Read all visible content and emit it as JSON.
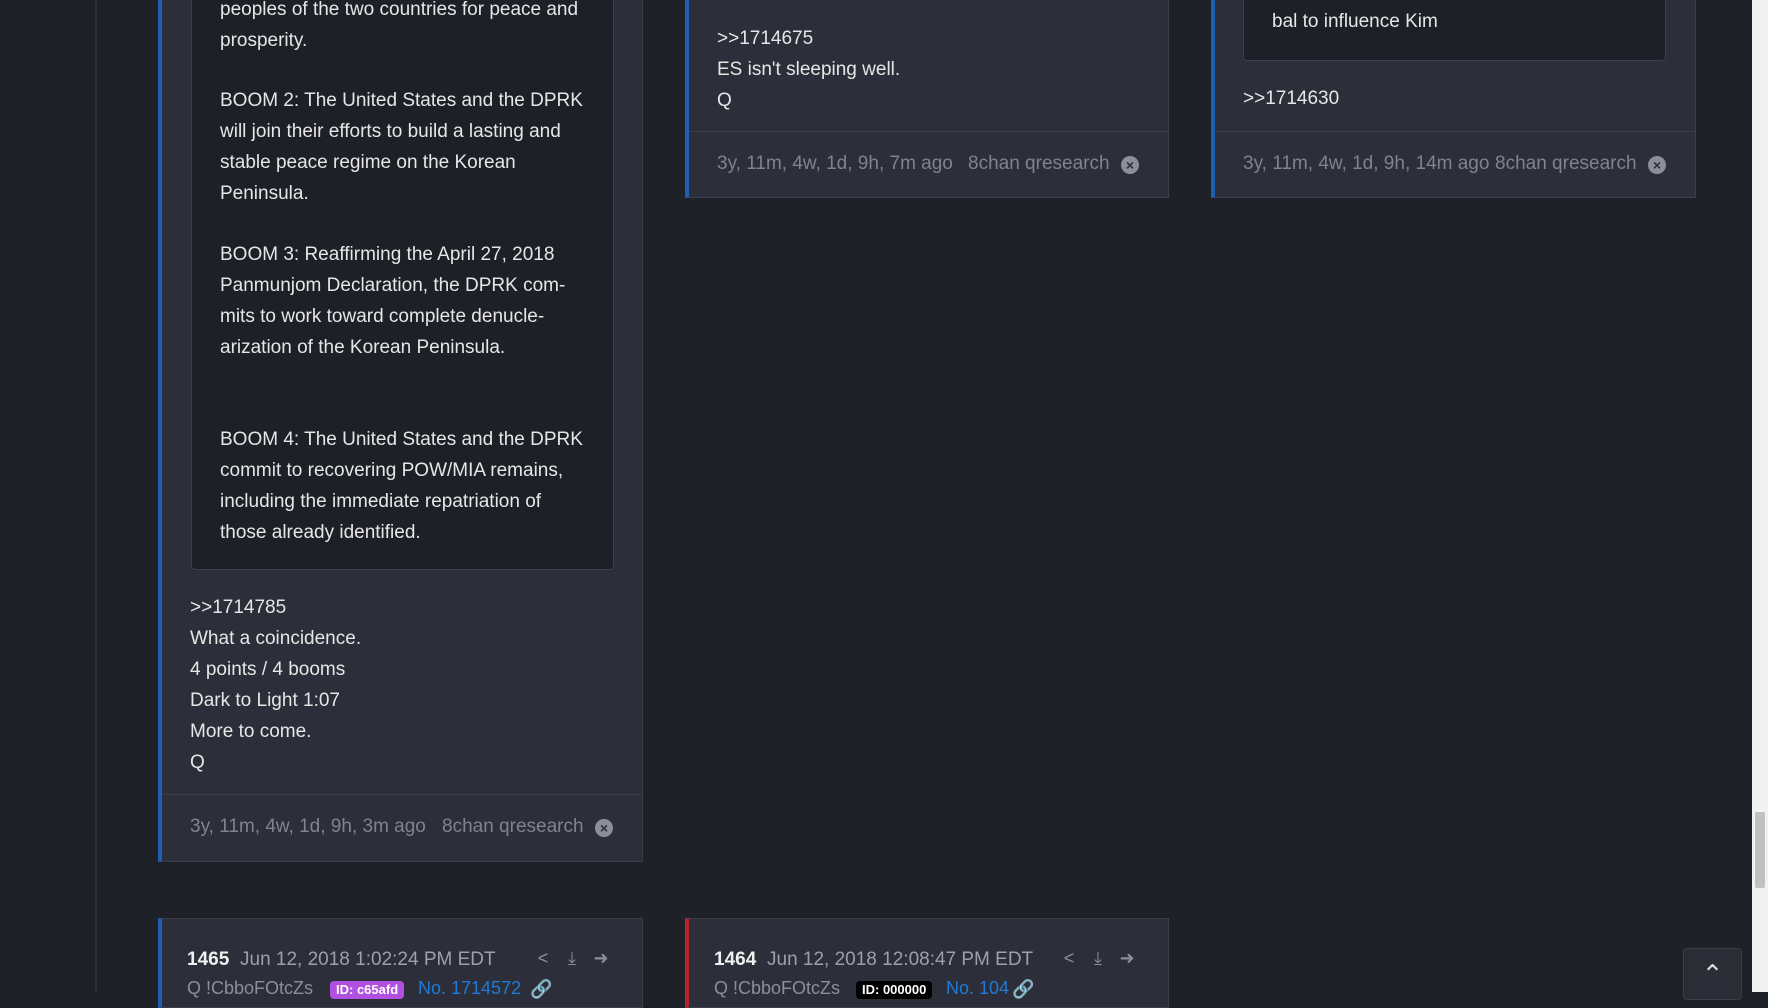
{
  "card_left": {
    "quote_lines": [
      "peoples of the two countries for peace and\nprosperity.",
      "BOOM 2: The United States and the DPRK\nwill join their efforts to build a lasting and\nstable peace regime on the Korean\nPeninsula.",
      "BOOM 3: Reaffirming the April 27, 2018\nPanmunjom Declaration, the DPRK com-\nmits to work toward complete denucle-\narization of the Korean Peninsula.",
      "BOOM 4: The United States and the DPRK\ncommit to recovering POW/MIA remains,\nincluding the immediate repatriation of\nthose already identified."
    ],
    "body": ">>1714785\nWhat a coincidence.\n4 points / 4 booms\nDark to Light 1:07\nMore to come.\nQ",
    "age": "3y, 11m, 4w, 1d, 9h, 3m ago",
    "source": "8chan qresearch"
  },
  "card_middle": {
    "body": ">>1714675\nES isn't sleeping well.\nQ",
    "age": "3y, 11m, 4w, 1d, 9h, 7m ago",
    "source": "8chan qresearch"
  },
  "card_right": {
    "quote_tail": "bal to influence Kim",
    "body": ">>1714630",
    "age": "3y, 11m, 4w, 1d, 9h, 14m ago",
    "source": "8chan qresearch"
  },
  "post_1465": {
    "number": "1465",
    "date": "Jun 12, 2018 1:02:24 PM EDT",
    "author": "Q !CbboFOtcZs",
    "id_badge": "ID: c65afd",
    "post_link": "No. 1714572"
  },
  "post_1464": {
    "number": "1464",
    "date": "Jun 12, 2018 12:08:47 PM EDT",
    "author": "Q !CbboFOtcZs",
    "id_badge": "ID: 000000",
    "post_link": "No. 104"
  },
  "colors": {
    "accent_blue": "#1e5fb3",
    "accent_red": "#b3262b",
    "badge_purple": "#b14fe0",
    "link_blue": "#1f7adb"
  },
  "icons": [
    "share-icon",
    "download-icon",
    "arrow-right-circle-icon",
    "close-circle-icon",
    "chevron-up-icon",
    "link-icon"
  ]
}
